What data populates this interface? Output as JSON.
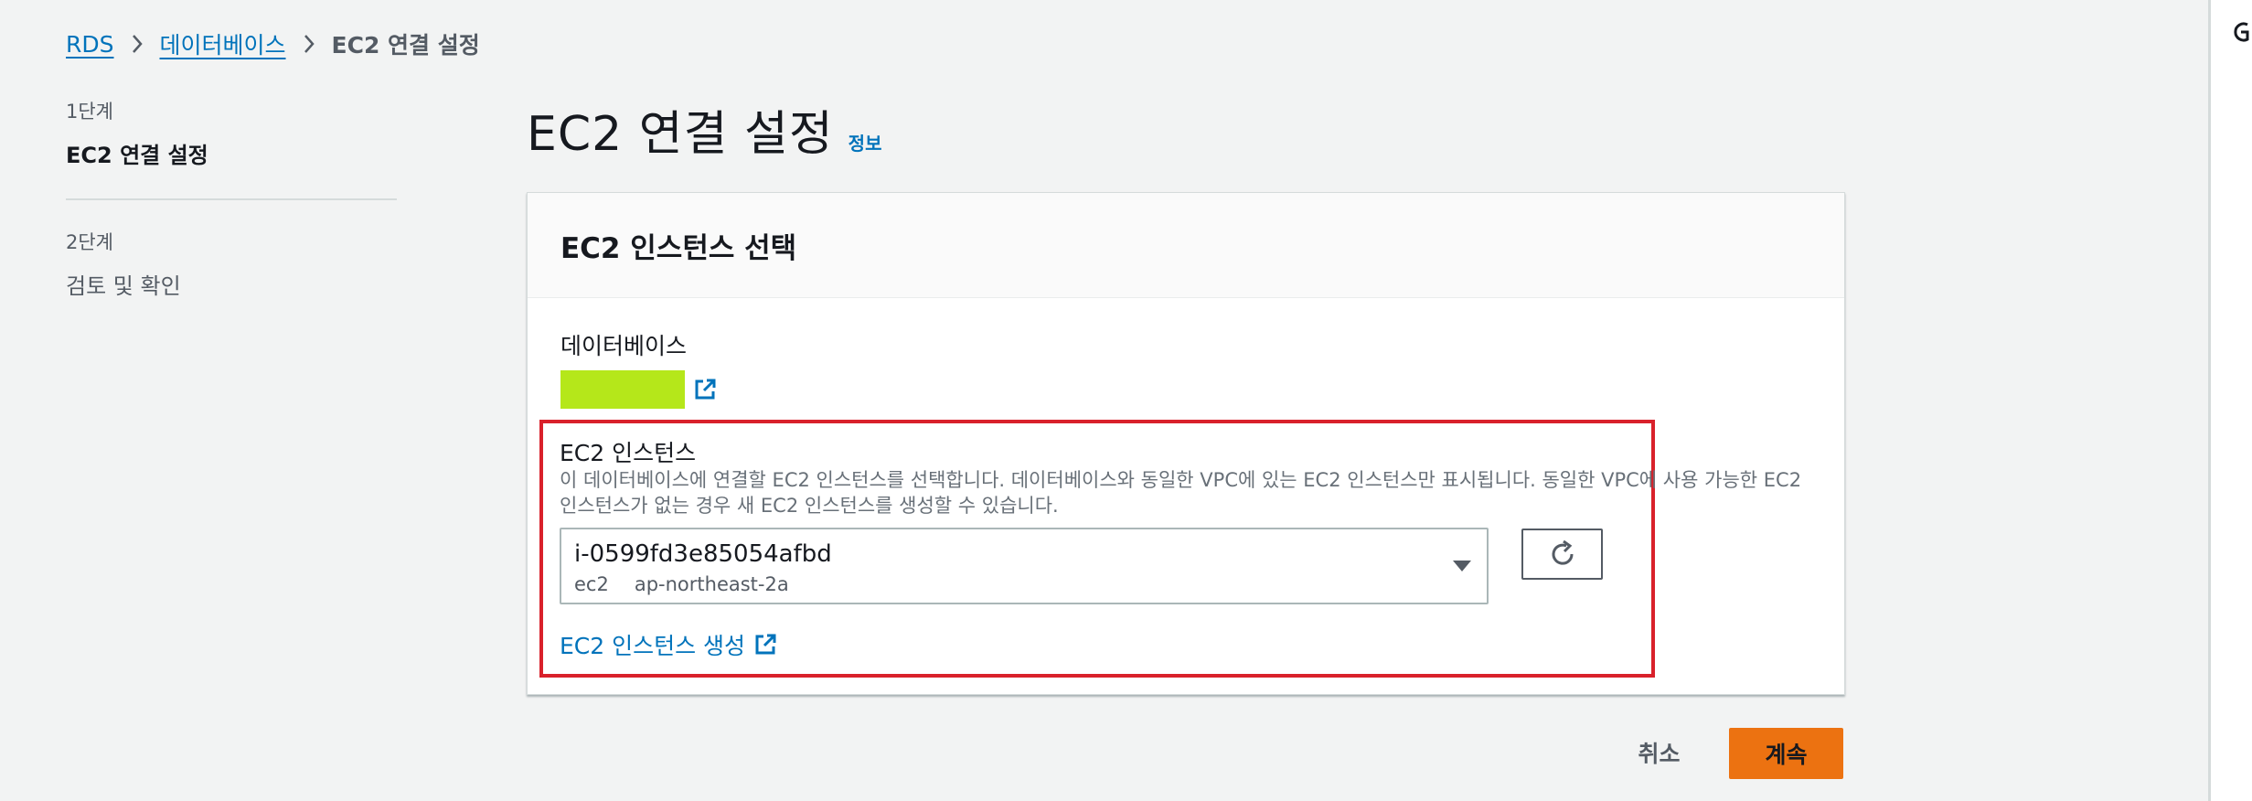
{
  "breadcrumb": {
    "items": [
      {
        "label": "RDS"
      },
      {
        "label": "데이터베이스"
      },
      {
        "label": "EC2 연결 설정"
      }
    ]
  },
  "steps": [
    {
      "step_label": "1단계",
      "title": "EC2 연결 설정"
    },
    {
      "step_label": "2단계",
      "title": "검토 및 확인"
    }
  ],
  "page": {
    "title": "EC2 연결 설정",
    "info_link": "정보"
  },
  "card": {
    "title": "EC2 인스턴스 선택",
    "database_label": "데이터베이스",
    "ec2_label": "EC2 인스턴스",
    "ec2_description": "이 데이터베이스에 연결할 EC2 인스턴스를 선택합니다. 데이터베이스와 동일한 VPC에 있는 EC2 인스턴스만 표시됩니다. 동일한 VPC에 사용 가능한 EC2 인스턴스가 없는 경우 새 EC2 인스턴스를 생성할 수 있습니다.",
    "selected_instance": {
      "id": "i-0599fd3e85054afbd",
      "name_tag": "ec2",
      "availability_zone": "ap-northeast-2a"
    },
    "create_link": "EC2 인스턴스 생성"
  },
  "footer": {
    "cancel_label": "취소",
    "continue_label": "계속"
  },
  "colors": {
    "link": "#0073bb",
    "primary_button": "#ec7211",
    "highlight_border": "#d9212b",
    "redacted": "#b5e71a"
  },
  "icons": {
    "breadcrumb_separator": "chevron-right-icon",
    "external_link": "external-link-icon",
    "select_caret": "caret-down-icon",
    "refresh": "refresh-icon"
  }
}
